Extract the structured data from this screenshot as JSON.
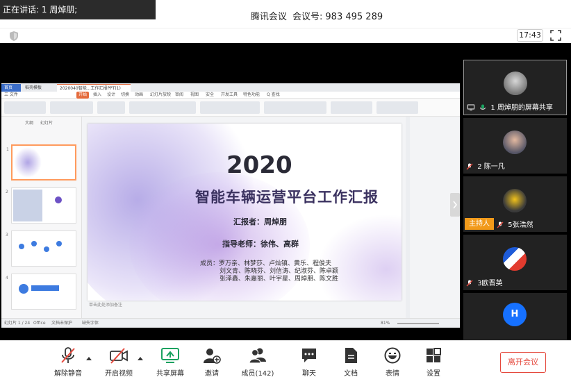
{
  "topbar": {
    "speaking": "正在讲话: 1 周焯朋;",
    "app_name": "腾讯会议",
    "meeting_id_label": "会议号:",
    "meeting_id": "983 495 289"
  },
  "infobar": {
    "clock": "17:43"
  },
  "shared": {
    "tabs": [
      "首页",
      "稻壳模板",
      "2020040智能...工作汇报PPT(1)"
    ],
    "menu": [
      "三 文件",
      "开始",
      "插入",
      "设计",
      "切换",
      "动画",
      "幻灯片放映",
      "审阅",
      "视图",
      "安全",
      "开发工具",
      "特色功能",
      "Q 查找"
    ],
    "left_tabs": [
      "大纲",
      "幻灯片"
    ],
    "slide_nums": [
      "1",
      "2",
      "3",
      "4"
    ],
    "status_left": "幻灯片 1 / 24",
    "status_theme": "Office",
    "status_protect": "文档未保护",
    "status_font": "缺失字体",
    "note": "单击此处添加备注",
    "zoom": "81%",
    "slide": {
      "year": "2020",
      "title": "智能车辆运营平台工作汇报",
      "reporter": "汇报者：周焯朋",
      "advisor": "指导老师：徐伟、高群",
      "members_1": "成员：罗万亲、林梦莎、卢灿镇、黄乐、程俊夫",
      "members_2": "刘文青、陈晓芬、刘信涛、纪淑芬、陈卓颖",
      "members_3": "张泽鑫、朱嘉丽、叶宇星、周焯朋、陈文胜"
    }
  },
  "participants": [
    {
      "label": "1 周焯朋的屏幕共享"
    },
    {
      "label": "2 陈一凡"
    },
    {
      "label": "5张浩然",
      "badge": "主持人"
    },
    {
      "label": "3欧晋英"
    },
    {
      "label": "",
      "initial": "H"
    }
  ],
  "toolbar": {
    "mute": "解除静音",
    "video": "开启视频",
    "share": "共享屏幕",
    "invite": "邀请",
    "members": "成员(142)",
    "chat": "聊天",
    "docs": "文档",
    "emoji": "表情",
    "settings": "设置",
    "leave": "离开会议"
  },
  "colors": {
    "accent": "#1671ff",
    "leave": "#e5483c",
    "host_badge": "#f29a1a",
    "share_icon": "#1aa260"
  }
}
